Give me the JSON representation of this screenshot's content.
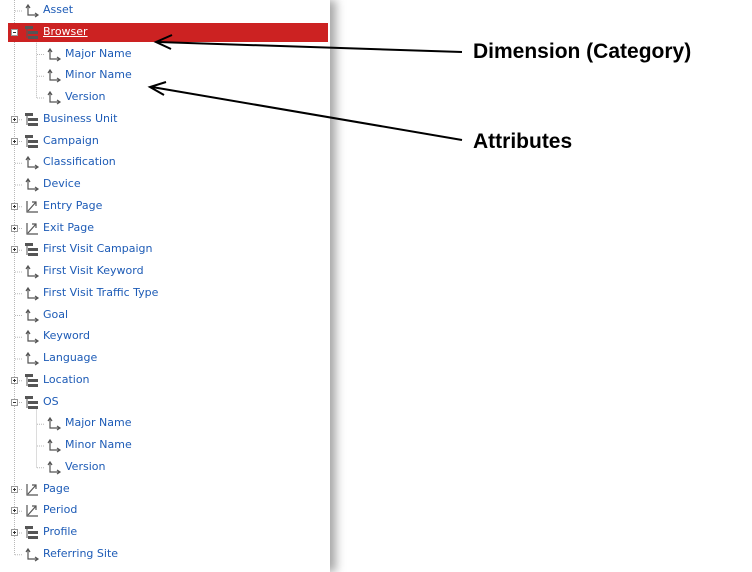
{
  "tree": {
    "items": [
      {
        "label": "Asset",
        "depth": 0,
        "type": "attribute",
        "expander": "none",
        "selected": false
      },
      {
        "label": "Browser",
        "depth": 0,
        "type": "dimension",
        "expander": "minus",
        "selected": true
      },
      {
        "label": "Major Name",
        "depth": 1,
        "type": "attribute",
        "expander": "none",
        "selected": false
      },
      {
        "label": "Minor Name",
        "depth": 1,
        "type": "attribute",
        "expander": "none",
        "selected": false
      },
      {
        "label": "Version",
        "depth": 1,
        "type": "attribute",
        "expander": "none",
        "selected": false
      },
      {
        "label": "Business Unit",
        "depth": 0,
        "type": "dimension",
        "expander": "plus",
        "selected": false
      },
      {
        "label": "Campaign",
        "depth": 0,
        "type": "dimension",
        "expander": "plus",
        "selected": false
      },
      {
        "label": "Classification",
        "depth": 0,
        "type": "attribute",
        "expander": "none",
        "selected": false
      },
      {
        "label": "Device",
        "depth": 0,
        "type": "attribute",
        "expander": "none",
        "selected": false
      },
      {
        "label": "Entry Page",
        "depth": 0,
        "type": "path",
        "expander": "plus",
        "selected": false
      },
      {
        "label": "Exit Page",
        "depth": 0,
        "type": "path",
        "expander": "plus",
        "selected": false
      },
      {
        "label": "First Visit Campaign",
        "depth": 0,
        "type": "dimension",
        "expander": "plus",
        "selected": false
      },
      {
        "label": "First Visit Keyword",
        "depth": 0,
        "type": "attribute",
        "expander": "none",
        "selected": false
      },
      {
        "label": "First Visit Traffic Type",
        "depth": 0,
        "type": "attribute",
        "expander": "none",
        "selected": false
      },
      {
        "label": "Goal",
        "depth": 0,
        "type": "attribute",
        "expander": "none",
        "selected": false
      },
      {
        "label": "Keyword",
        "depth": 0,
        "type": "attribute",
        "expander": "none",
        "selected": false
      },
      {
        "label": "Language",
        "depth": 0,
        "type": "attribute",
        "expander": "none",
        "selected": false
      },
      {
        "label": "Location",
        "depth": 0,
        "type": "dimension",
        "expander": "plus",
        "selected": false
      },
      {
        "label": "OS",
        "depth": 0,
        "type": "dimension",
        "expander": "minus",
        "selected": false
      },
      {
        "label": "Major Name",
        "depth": 1,
        "type": "attribute",
        "expander": "none",
        "selected": false
      },
      {
        "label": "Minor Name",
        "depth": 1,
        "type": "attribute",
        "expander": "none",
        "selected": false
      },
      {
        "label": "Version",
        "depth": 1,
        "type": "attribute",
        "expander": "none",
        "selected": false
      },
      {
        "label": "Page",
        "depth": 0,
        "type": "path",
        "expander": "plus",
        "selected": false
      },
      {
        "label": "Period",
        "depth": 0,
        "type": "path",
        "expander": "plus",
        "selected": false
      },
      {
        "label": "Profile",
        "depth": 0,
        "type": "dimension",
        "expander": "plus",
        "selected": false
      },
      {
        "label": "Referring Site",
        "depth": 0,
        "type": "attribute",
        "expander": "none",
        "selected": false
      }
    ]
  },
  "annotations": {
    "dimension": "Dimension (Category)",
    "attributes": "Attributes"
  },
  "colors": {
    "link": "#1d5bb6",
    "selected_bg": "#cc2222",
    "icon": "#555555"
  },
  "icons": {
    "dimension": "dimension-icon",
    "attribute": "attribute-icon",
    "path": "path-icon"
  }
}
